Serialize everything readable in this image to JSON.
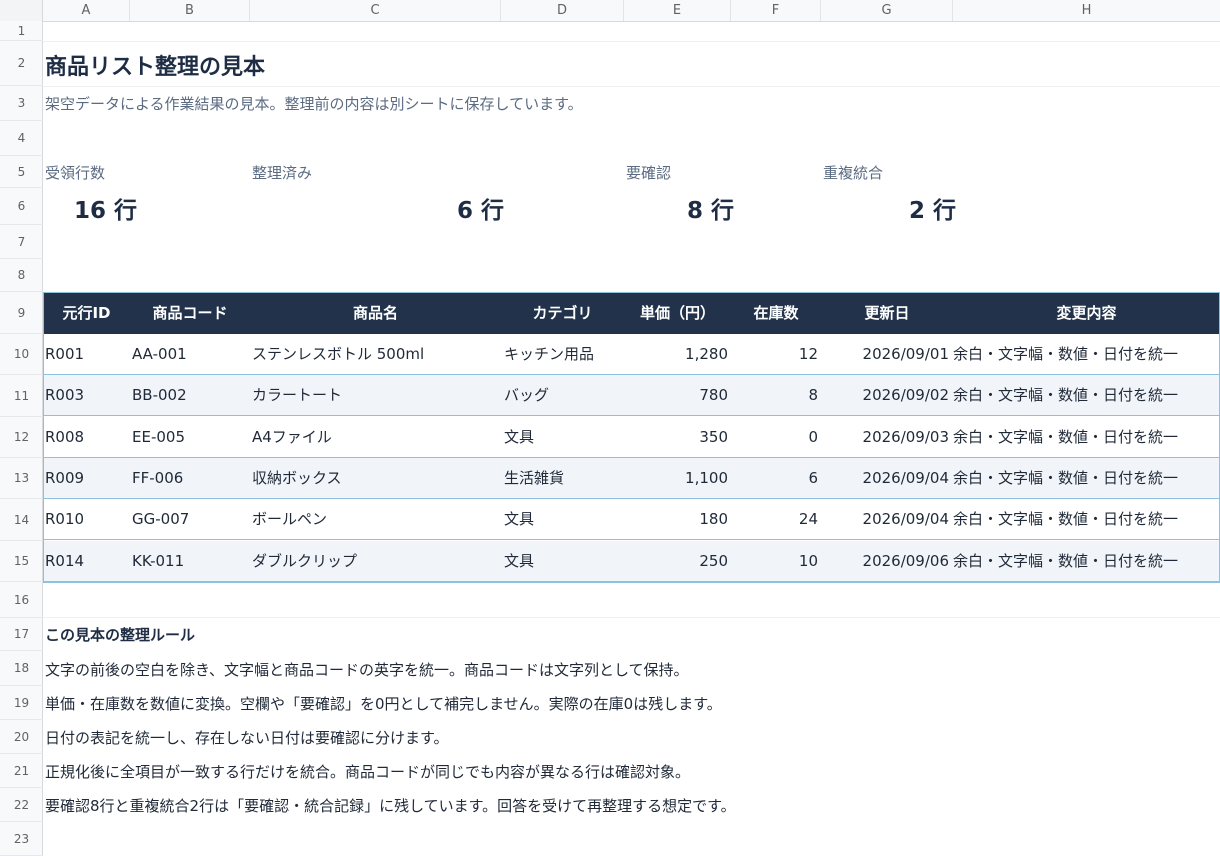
{
  "columns": [
    "A",
    "B",
    "C",
    "D",
    "E",
    "F",
    "G",
    "H"
  ],
  "rows": [
    "1",
    "2",
    "3",
    "4",
    "5",
    "6",
    "7",
    "8",
    "9",
    "10",
    "11",
    "12",
    "13",
    "14",
    "15",
    "16",
    "17",
    "18",
    "19",
    "20",
    "21",
    "22",
    "23"
  ],
  "title": "商品リスト整理の見本",
  "subtitle": "架空データによる作業結果の見本。整理前の内容は別シートに保存しています。",
  "stats": [
    {
      "label": "受領行数",
      "value": "16 行"
    },
    {
      "label": "整理済み",
      "value": "6 行"
    },
    {
      "label": "要確認",
      "value": "8 行"
    },
    {
      "label": "重複統合",
      "value": "2 行"
    }
  ],
  "table": {
    "headers": [
      "元行ID",
      "商品コード",
      "商品名",
      "カテゴリ",
      "単価（円）",
      "在庫数",
      "更新日",
      "変更内容"
    ],
    "rows": [
      [
        "R001",
        "AA-001",
        "ステンレスボトル 500ml",
        "キッチン用品",
        "1,280",
        "12",
        "2026/09/01",
        "余白・文字幅・数値・日付を統一"
      ],
      [
        "R003",
        "BB-002",
        "カラートート",
        "バッグ",
        "780",
        "8",
        "2026/09/02",
        "余白・文字幅・数値・日付を統一"
      ],
      [
        "R008",
        "EE-005",
        "A4ファイル",
        "文具",
        "350",
        "0",
        "2026/09/03",
        "余白・文字幅・数値・日付を統一"
      ],
      [
        "R009",
        "FF-006",
        "収納ボックス",
        "生活雑貨",
        "1,100",
        "6",
        "2026/09/04",
        "余白・文字幅・数値・日付を統一"
      ],
      [
        "R010",
        "GG-007",
        "ボールペン",
        "文具",
        "180",
        "24",
        "2026/09/04",
        "余白・文字幅・数値・日付を統一"
      ],
      [
        "R014",
        "KK-011",
        "ダブルクリップ",
        "文具",
        "250",
        "10",
        "2026/09/06",
        "余白・文字幅・数値・日付を統一"
      ]
    ]
  },
  "rules": {
    "title": "この見本の整理ルール",
    "items": [
      "文字の前後の空白を除き、文字幅と商品コードの英字を統一。商品コードは文字列として保持。",
      "単価・在庫数を数値に変換。空欄や「要確認」を0円として補完しません。実際の在庫0は残します。",
      "日付の表記を統一し、存在しない日付は要確認に分けます。",
      "正規化後に全項目が一致する行だけを統合。商品コードが同じでも内容が異なる行は確認対象。",
      "要確認8行と重複統合2行は「要確認・統合記録」に残しています。回答を受けて再整理する想定です。"
    ]
  },
  "colors": {
    "header_bg": "#21324a",
    "row_alt_bg": "#f1f5fa",
    "row_border": "#8cc3dc",
    "title_text": "#1f2d44",
    "muted_text": "#5b6b82"
  }
}
